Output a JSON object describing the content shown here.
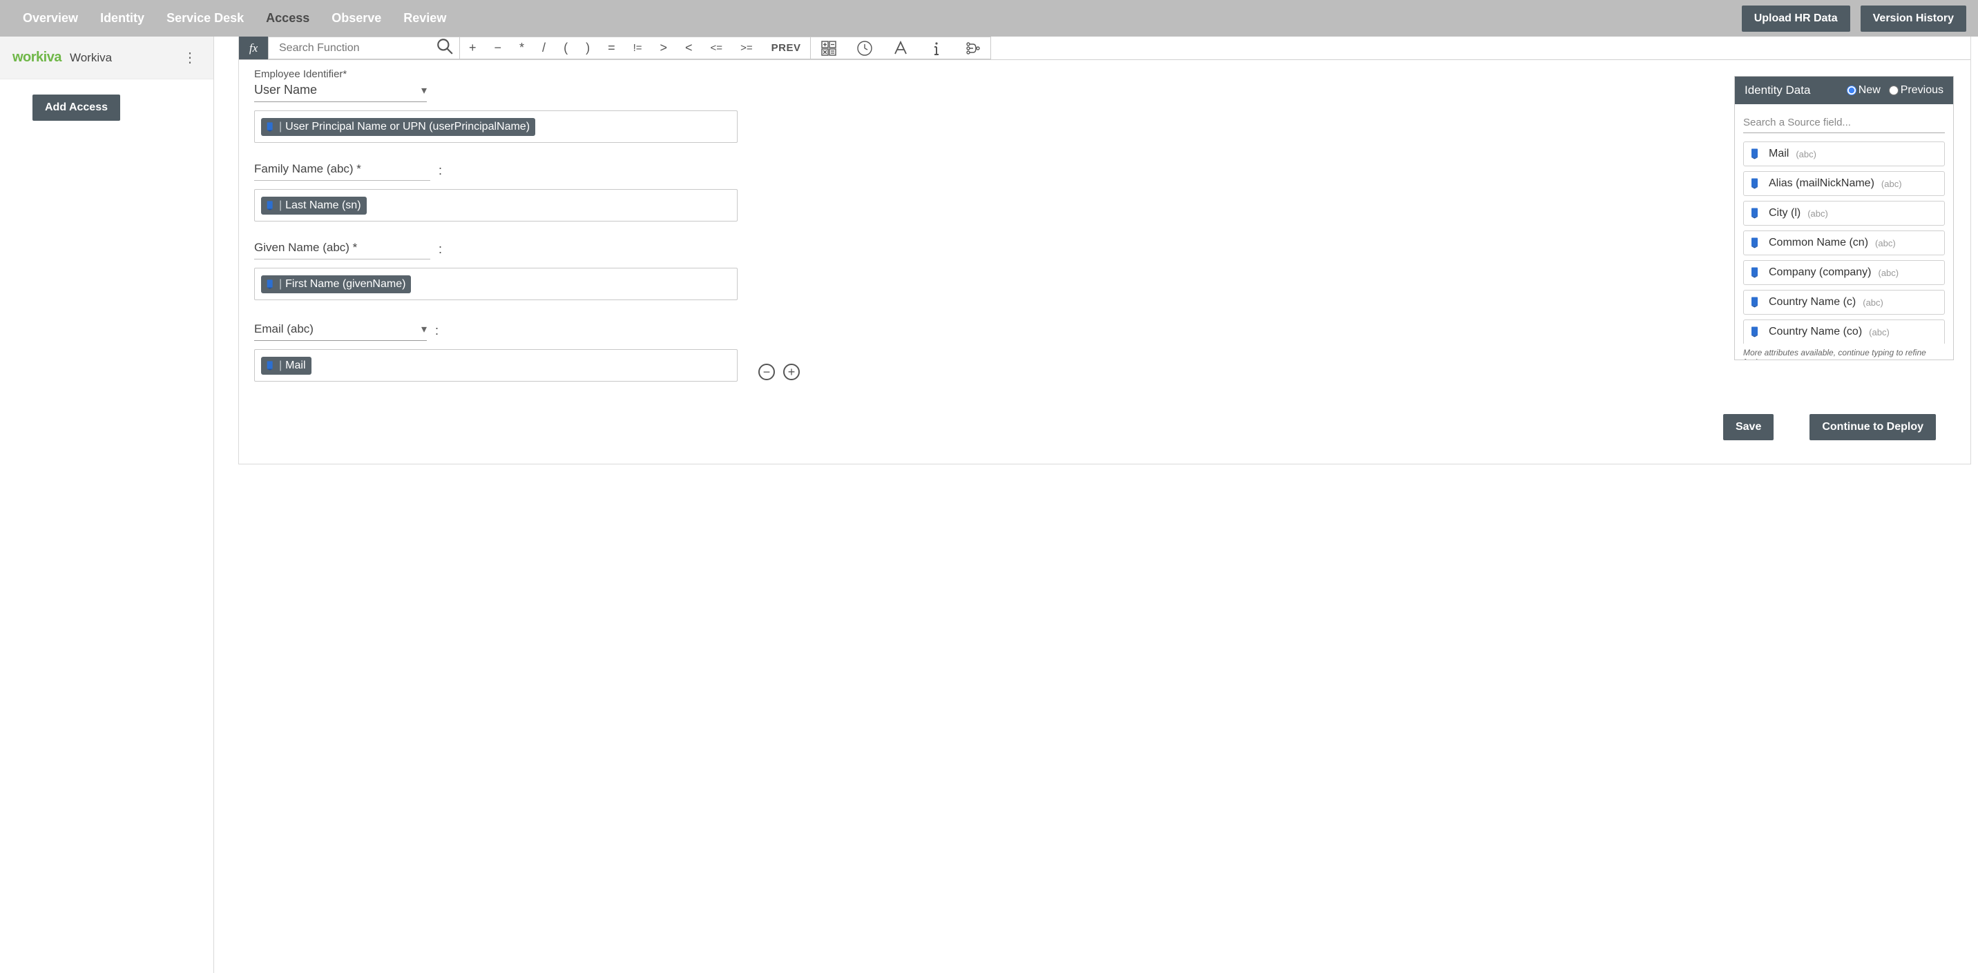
{
  "topnav": {
    "tabs": [
      "Overview",
      "Identity",
      "Service Desk",
      "Access",
      "Observe",
      "Review"
    ],
    "active_index": 3,
    "upload_label": "Upload HR Data",
    "version_label": "Version History"
  },
  "sidebar": {
    "app_logo": "workiva",
    "app_name": "Workiva",
    "add_access_label": "Add Access"
  },
  "formula_bar": {
    "fx_label": "fx",
    "search_placeholder": "Search Function",
    "operators": [
      "+",
      "−",
      "*",
      "/",
      "(",
      ")",
      "=",
      "!=",
      ">",
      "<",
      "<=",
      ">="
    ],
    "prev_label": "PREV"
  },
  "form": {
    "employee_identifier": {
      "label": "Employee Identifier*",
      "select_value": "User Name",
      "pill": "User Principal Name or UPN (userPrincipalName)"
    },
    "family_name": {
      "label": "Family Name (abc) *",
      "colon": ":",
      "pill": "Last Name (sn)"
    },
    "given_name": {
      "label": "Given Name (abc) *",
      "colon": ":",
      "pill": "First Name (givenName)"
    },
    "email": {
      "label": "Email (abc)",
      "colon": ":",
      "pill": "Mail"
    }
  },
  "identity_panel": {
    "title": "Identity Data",
    "radio_new": "New",
    "radio_prev": "Previous",
    "search_placeholder": "Search a Source field...",
    "items": [
      {
        "name": "Mail",
        "type": "(abc)"
      },
      {
        "name": "Alias (mailNickName)",
        "type": "(abc)"
      },
      {
        "name": "City (l)",
        "type": "(abc)"
      },
      {
        "name": "Common Name (cn)",
        "type": "(abc)"
      },
      {
        "name": "Company (company)",
        "type": "(abc)"
      },
      {
        "name": "Country Name (c)",
        "type": "(abc)"
      },
      {
        "name": "Country Name (co)",
        "type": "(abc)"
      }
    ],
    "more_note": "More attributes available, continue typing to refine further."
  },
  "footer": {
    "save": "Save",
    "deploy": "Continue to Deploy"
  }
}
